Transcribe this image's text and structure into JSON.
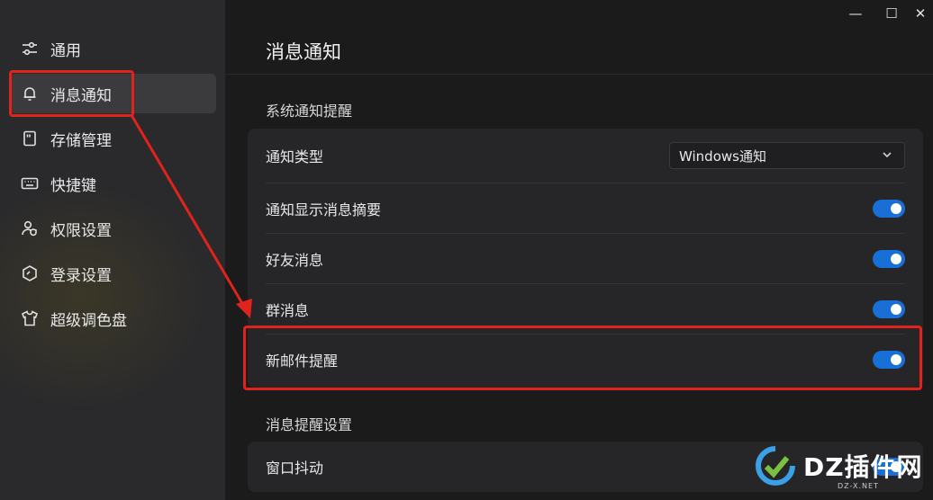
{
  "window": {
    "minimize_glyph": "—",
    "maximize_glyph": "☐",
    "close_glyph": "✕"
  },
  "sidebar": {
    "items": [
      {
        "label": "通用",
        "icon": "sliders-icon"
      },
      {
        "label": "消息通知",
        "icon": "bell-icon",
        "active": true
      },
      {
        "label": "存储管理",
        "icon": "storage-icon"
      },
      {
        "label": "快捷键",
        "icon": "keyboard-icon"
      },
      {
        "label": "权限设置",
        "icon": "user-shield-icon"
      },
      {
        "label": "登录设置",
        "icon": "hexagon-check-icon"
      },
      {
        "label": "超级调色盘",
        "icon": "tshirt-icon"
      }
    ]
  },
  "main": {
    "page_title": "消息通知",
    "section1": {
      "title": "系统通知提醒",
      "rows": [
        {
          "label": "通知类型",
          "control": "select",
          "value": "Windows通知"
        },
        {
          "label": "通知显示消息摘要",
          "control": "toggle",
          "on": true
        },
        {
          "label": "好友消息",
          "control": "toggle",
          "on": true
        },
        {
          "label": "群消息",
          "control": "toggle",
          "on": true
        },
        {
          "label": "新邮件提醒",
          "control": "toggle",
          "on": true
        }
      ]
    },
    "section2": {
      "title": "消息提醒设置",
      "rows": [
        {
          "label": "窗口抖动",
          "control": "toggle",
          "on": true
        }
      ]
    }
  },
  "annotation": {
    "color": "#e0231c"
  },
  "watermark": {
    "text": "DZ插件网",
    "sub": "DZ-X.NET"
  },
  "colors": {
    "toggle_on": "#1a6fd6",
    "sidebar_bg": "#2a2a2c",
    "main_bg": "#1b1b1c"
  }
}
